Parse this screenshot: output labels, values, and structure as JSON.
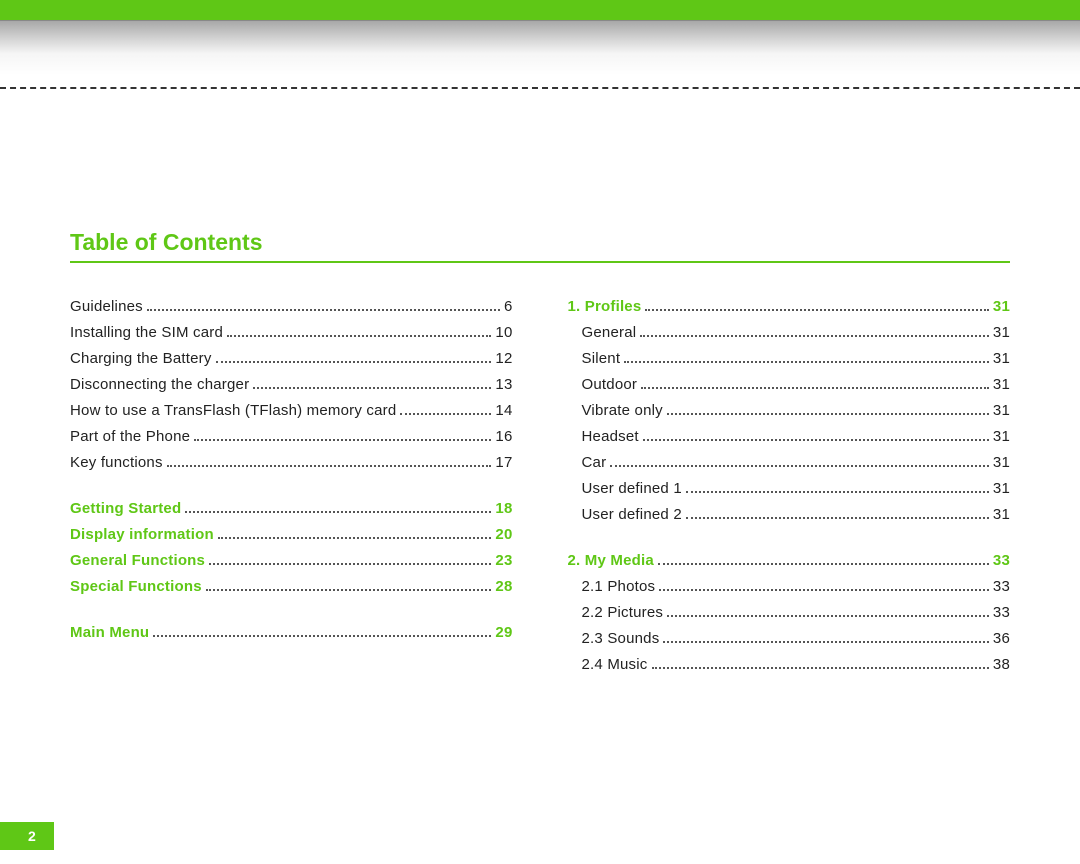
{
  "title": "Table of Contents",
  "pageNumber": "2",
  "left": [
    {
      "label": "Guidelines",
      "page": "6",
      "green": false
    },
    {
      "label": "Installing the SIM card",
      "page": "10",
      "green": false
    },
    {
      "label": "Charging the Battery",
      "page": "12",
      "green": false
    },
    {
      "label": "Disconnecting the charger",
      "page": "13",
      "green": false
    },
    {
      "label": "How to use a TransFlash (TFlash) memory card",
      "page": "14",
      "green": false
    },
    {
      "label": "Part of the Phone",
      "page": "16",
      "green": false
    },
    {
      "label": "Key functions",
      "page": "17",
      "green": false
    },
    {
      "gap": true
    },
    {
      "label": "Getting Started",
      "page": "18",
      "green": true
    },
    {
      "label": "Display information",
      "page": "20",
      "green": true
    },
    {
      "label": "General Functions",
      "page": "23",
      "green": true
    },
    {
      "label": "Special Functions",
      "page": "28",
      "green": true
    },
    {
      "gap": true
    },
    {
      "label": "Main Menu",
      "page": "29",
      "green": true
    }
  ],
  "right": [
    {
      "label": "1. Profiles",
      "page": "31",
      "green": true
    },
    {
      "label": "General",
      "page": "31",
      "green": false,
      "indent": true
    },
    {
      "label": "Silent",
      "page": "31",
      "green": false,
      "indent": true
    },
    {
      "label": "Outdoor",
      "page": "31",
      "green": false,
      "indent": true
    },
    {
      "label": "Vibrate only",
      "page": "31",
      "green": false,
      "indent": true
    },
    {
      "label": "Headset",
      "page": "31",
      "green": false,
      "indent": true
    },
    {
      "label": "Car",
      "page": "31",
      "green": false,
      "indent": true
    },
    {
      "label": "User defined 1",
      "page": "31",
      "green": false,
      "indent": true
    },
    {
      "label": "User defined 2",
      "page": "31",
      "green": false,
      "indent": true
    },
    {
      "gap": true
    },
    {
      "label": "2. My Media",
      "page": "33",
      "green": true
    },
    {
      "label": "2.1 Photos",
      "page": "33",
      "green": false,
      "indent": true
    },
    {
      "label": "2.2 Pictures",
      "page": "33",
      "green": false,
      "indent": true
    },
    {
      "label": "2.3 Sounds",
      "page": "36",
      "green": false,
      "indent": true
    },
    {
      "label": "2.4 Music",
      "page": "38",
      "green": false,
      "indent": true
    }
  ]
}
